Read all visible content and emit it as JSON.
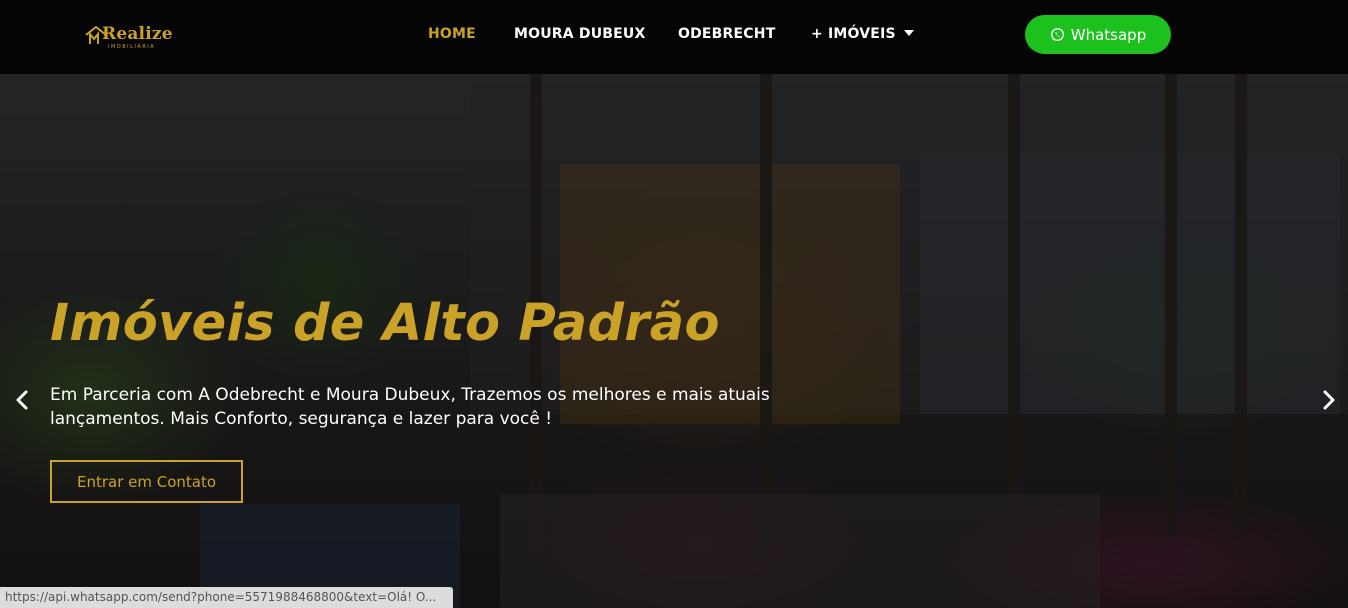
{
  "logo": {
    "word": "Realize",
    "sub": "IMOBILIÁRIA"
  },
  "nav": {
    "items": [
      {
        "label": "HOME",
        "active": true
      },
      {
        "label": "MOURA DUBEUX",
        "active": false
      },
      {
        "label": "ODEBRECHT",
        "active": false
      },
      {
        "label": "+ IMÓVEIS",
        "active": false,
        "has_dropdown": true
      }
    ]
  },
  "whatsapp_button": {
    "label": "Whatsapp",
    "icon": "whatsapp-icon",
    "color": "#1dc11d"
  },
  "hero": {
    "title": "Imóveis de Alto Padrão",
    "text": "Em Parceria com A Odebrecht e Moura Dubeux, Trazemos os melhores e mais atuais lançamentos. Mais Conforto, segurança e lazer para você !",
    "cta_label": "Entrar em Contato",
    "prev_icon": "chevron-left-icon",
    "next_icon": "chevron-right-icon"
  },
  "status_bar": {
    "url": "https://api.whatsapp.com/send?phone=5571988468800&text=Olá! O..."
  },
  "colors": {
    "accent": "#c9a227",
    "header_bg": "#050505",
    "text": "#ffffff"
  }
}
